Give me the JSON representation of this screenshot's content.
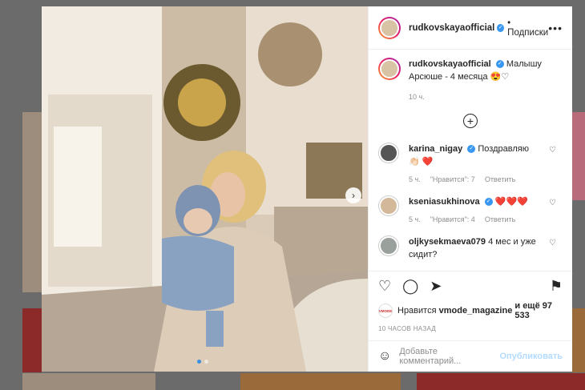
{
  "post": {
    "username": "rudkovskayaofficial",
    "follow_label": "• Подписки",
    "more_label": "•••",
    "caption_user": "rudkovskayaofficial",
    "caption_text": "Малышу Арсюше - 4 месяца 😍♡",
    "caption_time": "10 ч.",
    "load_more_label": "+"
  },
  "comments": [
    {
      "user": "karina_nigay",
      "text": "Поздравляю 👏🏻 ❤️",
      "time": "5 ч.",
      "likes": "\"Нравится\": 7",
      "reply": "Ответить",
      "verified": true
    },
    {
      "user": "kseniasukhinova",
      "text": "❤️❤️❤️",
      "time": "5 ч.",
      "likes": "\"Нравится\": 4",
      "reply": "Ответить",
      "verified": true
    },
    {
      "user": "oljkysekmaeva079",
      "text": "4 мес и уже сидит?",
      "verified": false
    }
  ],
  "actions": {
    "liked_by_prefix": "Нравится",
    "liked_by_user": "vmode_magazine",
    "liked_by_suffix": "и ещё 97 533",
    "mini_avatar_text": "VMODE",
    "posted_time": "10 ЧАСОВ НАЗАД",
    "comment_placeholder": "Добавьте комментарий...",
    "post_label": "Опубликовать"
  },
  "carousel": {
    "slides": 2,
    "current": 1
  },
  "colors": {
    "accent": "#3897f0",
    "heart": "#ed4956",
    "text": "#262626",
    "muted": "#8e8e8e"
  }
}
